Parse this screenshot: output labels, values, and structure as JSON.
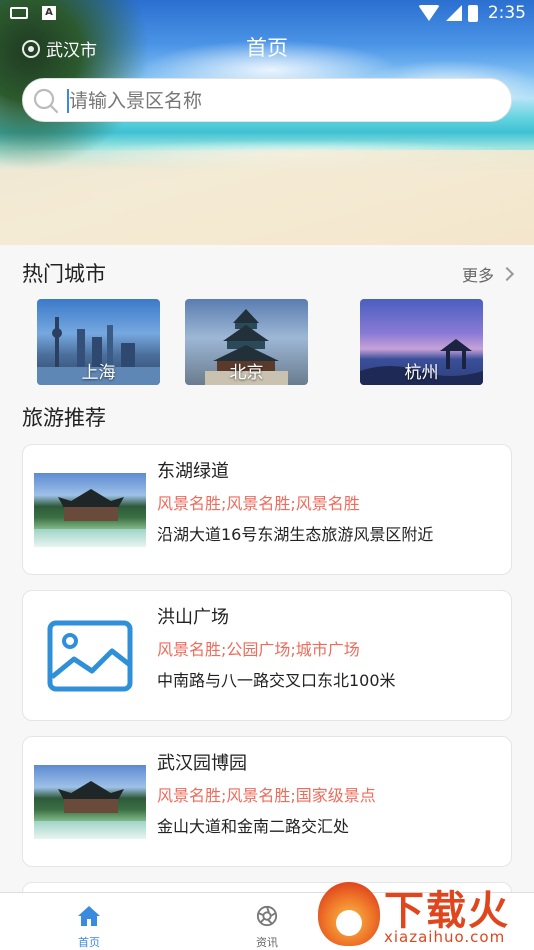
{
  "status_bar": {
    "time": "2:35"
  },
  "header": {
    "location": "武汉市",
    "title": "首页"
  },
  "search": {
    "placeholder": "请输入景区名称"
  },
  "hot_cities": {
    "title": "热门城市",
    "more_label": "更多",
    "items": [
      {
        "label": "上海"
      },
      {
        "label": "北京"
      },
      {
        "label": "杭州"
      }
    ]
  },
  "recommend": {
    "title": "旅游推荐",
    "items": [
      {
        "name": "东湖绿道",
        "tags": "风景名胜;风景名胜;风景名胜",
        "address": "沿湖大道16号东湖生态旅游风景区附近"
      },
      {
        "name": "洪山广场",
        "tags": "风景名胜;公园广场;城市广场",
        "address": "中南路与八一路交叉口东北100米"
      },
      {
        "name": "武汉园博园",
        "tags": "风景名胜;风景名胜;国家级景点",
        "address": "金山大道和金南二路交汇处"
      }
    ]
  },
  "bottom_nav": [
    {
      "label": "首页",
      "active": true
    },
    {
      "label": "资讯",
      "active": false
    }
  ],
  "watermark": {
    "title": "下载火",
    "url": "xiazaihuo.com"
  },
  "colors": {
    "accent": "#3a8be0",
    "tag": "#ef6b5b",
    "watermark": "#e0461e"
  }
}
